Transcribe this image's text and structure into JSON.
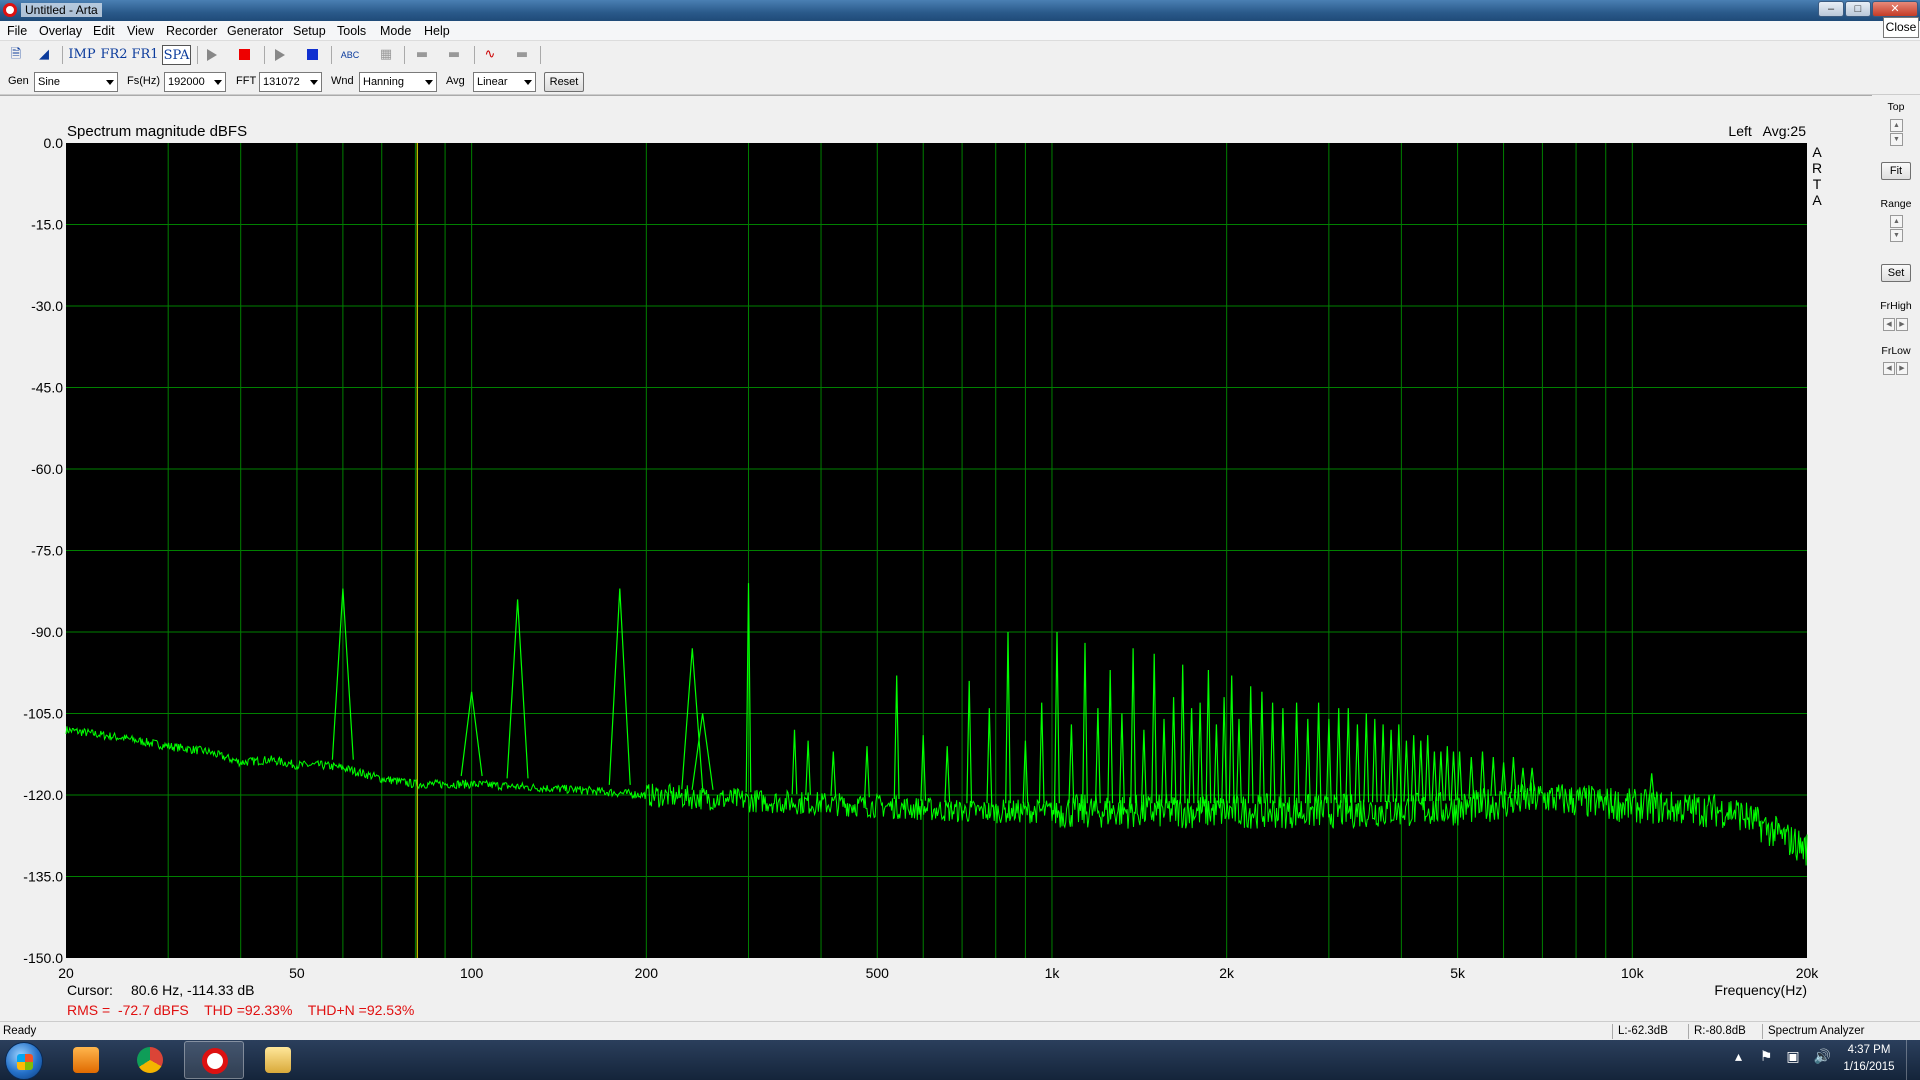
{
  "window": {
    "title": "Untitled - Arta",
    "close_tooltip": "Close"
  },
  "menu": [
    "File",
    "Overlay",
    "Edit",
    "View",
    "Recorder",
    "Generator",
    "Setup",
    "Tools",
    "Mode",
    "Help"
  ],
  "toolbar": {
    "imp": "IMP",
    "fr2": "FR2",
    "fr1": "FR1",
    "spa": "SPA",
    "abc": "ABC"
  },
  "params": {
    "gen_label": "Gen",
    "gen_value": "Sine",
    "fs_label": "Fs(Hz)",
    "fs_value": "192000",
    "fft_label": "FFT",
    "fft_value": "131072",
    "wnd_label": "Wnd",
    "wnd_value": "Hanning",
    "avg_label": "Avg",
    "avg_value": "Linear",
    "reset_label": "Reset"
  },
  "right_panel": {
    "top_label": "Top",
    "fit_label": "Fit",
    "range_label": "Range",
    "set_label": "Set",
    "frhigh_label": "FrHigh",
    "frlow_label": "FrLow"
  },
  "plot": {
    "title": "Spectrum magnitude dBFS",
    "channel_info": "Left   Avg:25",
    "brand_letters": [
      "A",
      "R",
      "T",
      "A"
    ],
    "cursor_label": "Cursor:",
    "cursor_value": "80.6 Hz, -114.33 dB",
    "measurements": "RMS =  -72.7 dBFS    THD =92.33%    THD+N =92.53%",
    "xlabel": "Frequency(Hz)",
    "colors": {
      "trace": "#00ff00",
      "grid": "#008000",
      "cursor": "#c8c800",
      "background": "#000000",
      "measure_text": "#e01010"
    }
  },
  "chart_data": {
    "type": "line",
    "title": "Spectrum magnitude dBFS",
    "xlabel": "Frequency(Hz)",
    "ylabel": "",
    "x_scale": "log",
    "xlim": [
      20,
      20000
    ],
    "ylim": [
      -150,
      0
    ],
    "x_ticks": [
      20,
      50,
      100,
      200,
      500,
      1000,
      2000,
      5000,
      10000,
      20000
    ],
    "x_tick_labels": [
      "20",
      "50",
      "100",
      "200",
      "500",
      "1k",
      "2k",
      "5k",
      "10k",
      "20k"
    ],
    "y_ticks": [
      0,
      -15,
      -30,
      -45,
      -60,
      -75,
      -90,
      -105,
      -120,
      -135,
      -150
    ],
    "y_tick_labels": [
      "0.0",
      "-15.0",
      "-30.0",
      "-45.0",
      "-60.0",
      "-75.0",
      "-90.0",
      "-105.0",
      "-120.0",
      "-135.0",
      "-150.0"
    ],
    "grid": true,
    "cursor_x": 80.6,
    "series": [
      {
        "noise_floor": {
          "x": [
            20,
            25,
            30,
            35,
            40,
            45,
            50,
            55,
            60,
            70,
            80,
            100,
            150,
            200,
            300,
            500,
            700,
            1000,
            2000,
            3000,
            5000,
            7000,
            10000,
            15000,
            20000
          ],
          "y": [
            -108,
            -109.5,
            -111,
            -112,
            -114,
            -113.5,
            -114.5,
            -114.5,
            -115,
            -117,
            -118,
            -118,
            -119,
            -120,
            -121,
            -122,
            -123,
            -123,
            -123,
            -123,
            -122.5,
            -120.5,
            -122,
            -123,
            -130
          ]
        },
        "peaks": {
          "x": [
            60,
            100,
            120,
            180,
            240,
            250,
            300,
            360,
            380,
            420,
            480,
            540,
            600,
            660,
            720,
            780,
            840,
            900,
            960,
            1020,
            1080,
            1140,
            1200,
            1260,
            1320,
            1380,
            1440,
            1500,
            1560,
            1620,
            1680,
            1740,
            1800,
            1860,
            1920,
            1980,
            2040,
            2100,
            2200,
            2300,
            2400,
            2500,
            2640,
            2760,
            2880,
            3000,
            3120,
            3240,
            3360,
            3480,
            3600,
            3720,
            3840,
            3960,
            4080,
            4200,
            4320,
            4440,
            4560,
            4680,
            4800,
            4920,
            5040,
            5280,
            5520,
            5760,
            6000,
            6240,
            6480,
            6720,
            10800
          ],
          "y": [
            -82,
            -101,
            -84,
            -82,
            -93,
            -105,
            -81,
            -108,
            -110,
            -112,
            -111,
            -98,
            -109,
            -111,
            -99,
            -104,
            -90,
            -110,
            -103,
            -90,
            -107,
            -92,
            -104,
            -97,
            -105,
            -93,
            -108,
            -94,
            -106,
            -102,
            -96,
            -104,
            -103,
            -97,
            -107,
            -102,
            -98,
            -106,
            -100,
            -101,
            -103,
            -104,
            -103,
            -106,
            -103,
            -106,
            -104,
            -104,
            -107,
            -105,
            -106,
            -107,
            -108,
            -107,
            -110,
            -109,
            -110,
            -109,
            -112,
            -112,
            -111,
            -112,
            -112,
            -113,
            -112,
            -113,
            -114,
            -113,
            -115,
            -115,
            -116
          ]
        }
      }
    ]
  },
  "status": {
    "ready": "Ready",
    "left_level": "L:-62.3dB",
    "right_level": "R:-80.8dB",
    "mode": "Spectrum Analyzer"
  },
  "taskbar": {
    "time": "4:37 PM",
    "date": "1/16/2015"
  }
}
